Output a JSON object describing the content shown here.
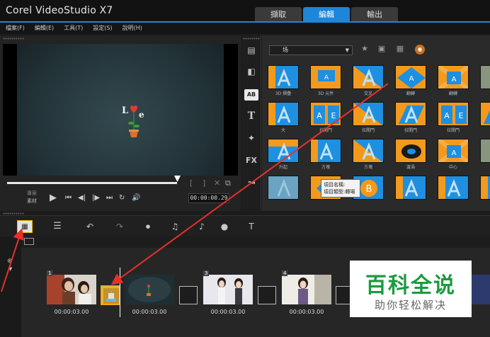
{
  "app": {
    "title": "Corel VideoStudio X7"
  },
  "mode_tabs": [
    {
      "label": "擷取",
      "active": false
    },
    {
      "label": "編輯",
      "active": true
    },
    {
      "label": "輸出",
      "active": false
    }
  ],
  "menu": [
    "檔案(F)",
    "編輯(E)",
    "工具(T)",
    "設定(S)",
    "說明(H)"
  ],
  "preview": {
    "mode_project": "專案",
    "mode_clip": "素材",
    "timecode": "00:00:00.29"
  },
  "library": {
    "category": "场",
    "side_icons": [
      {
        "name": "media-icon",
        "glyph": "▤"
      },
      {
        "name": "instant-project-icon",
        "glyph": "◧"
      },
      {
        "name": "transition-icon",
        "glyph": "AB",
        "active": true
      },
      {
        "name": "title-icon",
        "glyph": "T"
      },
      {
        "name": "graphic-icon",
        "glyph": "✦"
      },
      {
        "name": "filter-icon",
        "glyph": "FX"
      },
      {
        "name": "path-icon",
        "glyph": "↝"
      }
    ],
    "thumbnails": [
      {
        "label": "3D 摺疊",
        "style": "a"
      },
      {
        "label": "3D 元件",
        "style": "b"
      },
      {
        "label": "交叉",
        "style": "c"
      },
      {
        "label": "翻轉",
        "style": "d"
      },
      {
        "label": "翻轉",
        "style": "e"
      },
      {
        "label": "",
        "style": "f"
      },
      {
        "label": "大",
        "style": "a"
      },
      {
        "label": "拉開門",
        "style": "g"
      },
      {
        "label": "拉開門",
        "style": "c"
      },
      {
        "label": "拉開門",
        "style": "h"
      },
      {
        "label": "拉開門",
        "style": "g"
      },
      {
        "label": "",
        "style": "h"
      },
      {
        "label": "升起",
        "style": "i"
      },
      {
        "label": "方塊",
        "style": "a"
      },
      {
        "label": "方塊",
        "style": "c"
      },
      {
        "label": "漩渦",
        "style": "j"
      },
      {
        "label": "中心",
        "style": "e"
      },
      {
        "label": "",
        "style": "f"
      },
      {
        "label": "",
        "style": "k"
      },
      {
        "label": "",
        "style": "l"
      },
      {
        "label": "",
        "style": "m"
      },
      {
        "label": "",
        "style": "a"
      },
      {
        "label": "",
        "style": "a"
      },
      {
        "label": "",
        "style": "a"
      }
    ],
    "tooltip": {
      "line1": "項目名稱:",
      "line2": "項目類型:轉場"
    }
  },
  "timeline": {
    "clips": [
      {
        "number": "1",
        "duration": "00:00:03.00",
        "style": "photo1"
      },
      {
        "number": "",
        "duration": "00:00:03.00",
        "style": "video"
      },
      {
        "number": "3",
        "duration": "00:00:03.00",
        "style": "photo3"
      },
      {
        "number": "4",
        "duration": "00:00:03.00",
        "style": "photo4"
      }
    ]
  },
  "watermark": {
    "main": "百科全说",
    "sub": "助你轻松解决"
  },
  "colors": {
    "accent": "#1d86d8",
    "transition_orange": "#f39a1c",
    "transition_blue": "#1f8fe0",
    "annotation_red": "#e8302a"
  }
}
